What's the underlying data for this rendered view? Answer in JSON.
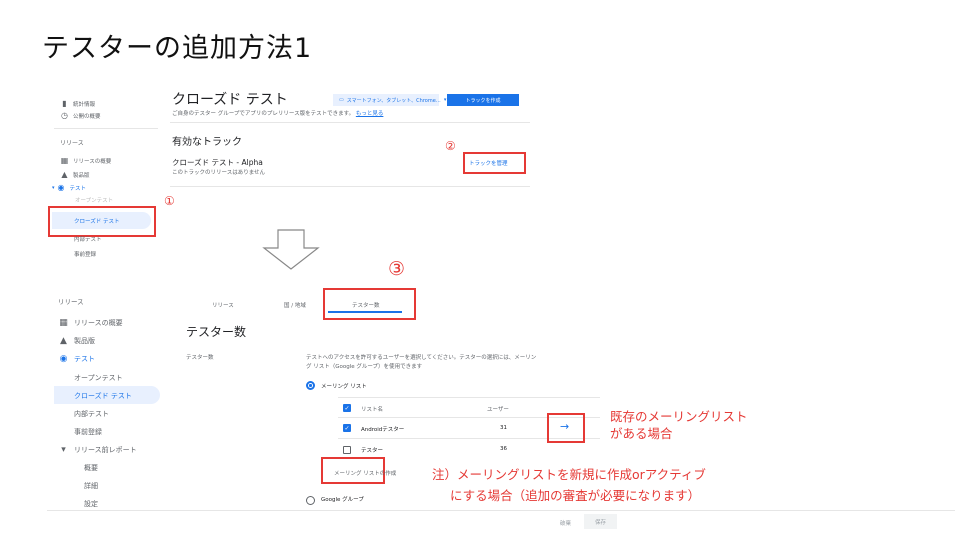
{
  "slide_title": "テスターの追加方法1",
  "top": {
    "nav": [
      {
        "icon": "bar-chart-icon",
        "glyph": "▮",
        "label": "統計情報"
      },
      {
        "icon": "overview-icon",
        "glyph": "◷",
        "label": "公開の概要"
      }
    ],
    "release_section": "リリース",
    "release_nav": [
      {
        "icon": "grid-icon",
        "glyph": "▦",
        "label": "リリースの概要"
      },
      {
        "icon": "bundle-icon",
        "glyph": "▲",
        "label": "製品版"
      },
      {
        "icon": "testing-icon",
        "glyph": "◉",
        "label": "テスト"
      }
    ],
    "sub_open": "オープンテスト",
    "sub_closed": "クローズド テスト",
    "sub_internal": "内部テスト",
    "sub_prereg": "事前登録",
    "heading": "クローズド テスト",
    "description": "ご自身のテスター グループでアプリのプレリリース版をテストできます。",
    "learn_more": "もっと見る",
    "device_chip": "スマートフォン、タブレット、Chrome…",
    "create_track": "トラックを作成",
    "active_tracks": "有効なトラック",
    "track_name": "クローズド テスト - Alpha",
    "track_note": "このトラックのリリースはありません",
    "manage_track": "トラックを管理"
  },
  "annotations": {
    "one": "①",
    "two": "②",
    "three": "③",
    "existing_list": "既存のメーリングリスト",
    "existing_list2": "がある場合",
    "note_line1": "注）メーリングリストを新規に作成orアクティブ",
    "note_line2": "にする場合（追加の審査が必要になります）"
  },
  "bottom": {
    "release_section": "リリース",
    "nav": [
      {
        "icon": "grid-icon",
        "glyph": "▦",
        "label": "リリースの概要"
      },
      {
        "icon": "bundle-icon",
        "glyph": "▲",
        "label": "製品版"
      },
      {
        "icon": "testing-icon",
        "glyph": "◉",
        "label": "テスト"
      }
    ],
    "sub": [
      "オープンテスト",
      "クローズド テスト",
      "内部テスト",
      "事前登録"
    ],
    "pre_launch": "リリース前レポート",
    "pre_sub": [
      "概要",
      "詳細",
      "設定"
    ],
    "tabs": [
      "リリース",
      "国 / 地域",
      "テスター数"
    ],
    "heading": "テスター数",
    "testers_label": "テスター数",
    "instructions_1": "テストへのアクセスを許可するユーザーを選択してください。テスターの選択には、メーリン",
    "instructions_2": "グ リスト（Google グループ）を使用できます",
    "option_email": "メーリング リスト",
    "col_list_name": "リスト名",
    "col_users": "ユーザー",
    "lists": [
      {
        "name": "Androidテスター",
        "users": "31",
        "checked": true
      },
      {
        "name": "テスター",
        "users": "36",
        "checked": false
      }
    ],
    "create_list": "メーリング リストの作成",
    "option_google": "Google グループ",
    "discard": "破棄",
    "save": "保存"
  }
}
